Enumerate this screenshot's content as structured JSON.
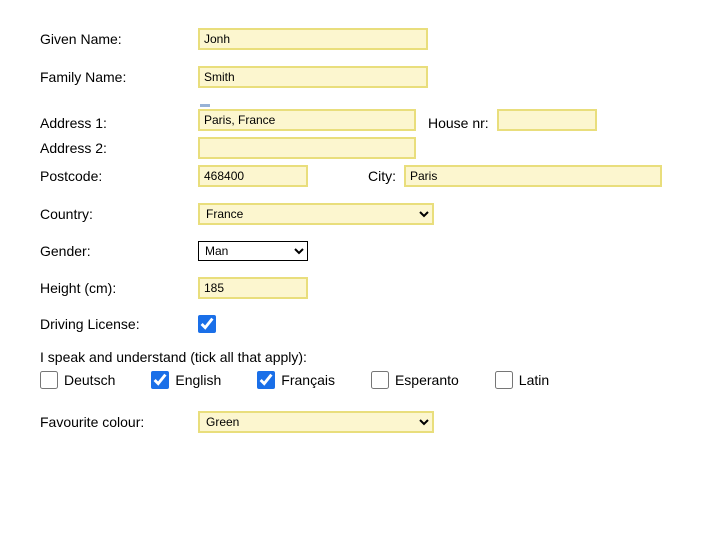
{
  "form": {
    "given_name": {
      "label": "Given Name:",
      "value": "Jonh"
    },
    "family_name": {
      "label": "Family Name:",
      "value": "Smith"
    },
    "address1": {
      "label": "Address 1:",
      "value": "Paris, France"
    },
    "address2": {
      "label": "Address 2:",
      "value": ""
    },
    "house_nr": {
      "label": "House nr:",
      "value": ""
    },
    "postcode": {
      "label": "Postcode:",
      "value": "468400"
    },
    "city": {
      "label": "City:",
      "value": "Paris"
    },
    "country": {
      "label": "Country:",
      "value": "France",
      "options": [
        "France"
      ]
    },
    "gender": {
      "label": "Gender:",
      "value": "Man",
      "options": [
        "Man"
      ]
    },
    "height": {
      "label": "Height (cm):",
      "value": "185"
    },
    "driving_license": {
      "label": "Driving License:",
      "checked": true
    },
    "languages": {
      "prompt": "I speak and understand (tick all that apply):",
      "items": [
        {
          "label": "Deutsch",
          "checked": false
        },
        {
          "label": "English",
          "checked": true
        },
        {
          "label": "Français",
          "checked": true
        },
        {
          "label": "Esperanto",
          "checked": false
        },
        {
          "label": "Latin",
          "checked": false
        }
      ]
    },
    "favourite_colour": {
      "label": "Favourite colour:",
      "value": "Green",
      "options": [
        "Green"
      ]
    }
  }
}
